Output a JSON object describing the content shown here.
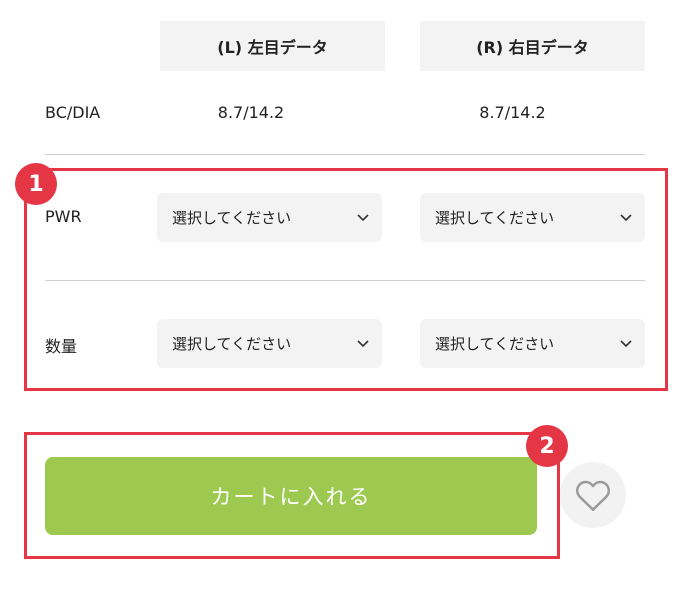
{
  "headers": {
    "left": "(L) 左目データ",
    "right": "(R) 右目データ"
  },
  "bc_dia": {
    "label": "BC/DIA",
    "left": "8.7/14.2",
    "right": "8.7/14.2"
  },
  "pwr": {
    "label": "PWR",
    "left_select": "選択してください",
    "right_select": "選択してください"
  },
  "quantity": {
    "label": "数量",
    "left_select": "選択してください",
    "right_select": "選択してください"
  },
  "annotations": {
    "badge_1": "1",
    "badge_2": "2",
    "color": "#e53646"
  },
  "cart": {
    "label": "カートに入れる",
    "color": "#9dc951"
  },
  "icons": {
    "select_arrow": "chevron-down-icon",
    "favorite": "heart-icon"
  }
}
